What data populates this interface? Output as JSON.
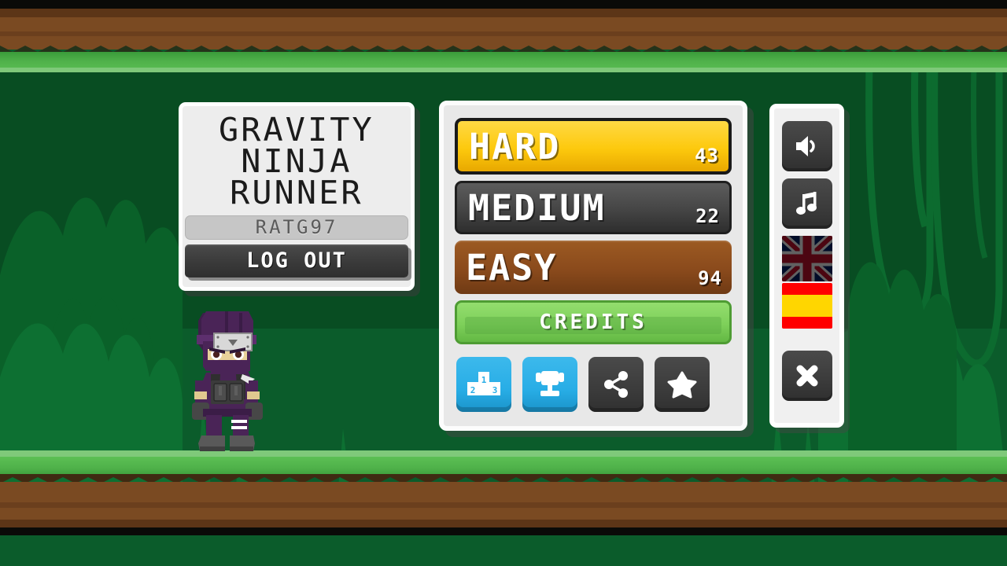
{
  "app": {
    "title_lines": [
      "GRAVITY",
      "NINJA",
      "RUNNER"
    ],
    "username": "RATG97",
    "logout_label": "LOG OUT"
  },
  "menu": {
    "difficulties": [
      {
        "label": "HARD",
        "score": "43",
        "color": "#fdc90d",
        "selected": true
      },
      {
        "label": "MEDIUM",
        "score": "22",
        "color": "#454545",
        "selected": false
      },
      {
        "label": "EASY",
        "score": "94",
        "color": "#8a4a1c",
        "selected": false
      }
    ],
    "credits_label": "CREDITS",
    "icons": [
      {
        "name": "leaderboard-icon",
        "style": "blue",
        "numbers": [
          "1",
          "2",
          "3"
        ]
      },
      {
        "name": "achievements-icon",
        "style": "blue"
      },
      {
        "name": "share-icon",
        "style": "dark"
      },
      {
        "name": "rate-star-icon",
        "style": "dark"
      }
    ]
  },
  "sidebar": {
    "buttons": [
      {
        "name": "sound-toggle",
        "icon": "speaker-icon"
      },
      {
        "name": "music-toggle",
        "icon": "music-note-icon"
      },
      {
        "name": "language-en",
        "icon": "uk-flag-icon",
        "active": false
      },
      {
        "name": "language-es",
        "icon": "spain-flag-icon",
        "active": true
      },
      {
        "name": "close-button",
        "icon": "close-x-icon"
      }
    ]
  },
  "scene": {
    "character": "ninja-sprite",
    "background": "jungle-grass",
    "colors": {
      "grass_light": "#5cc054",
      "grass_dark": "#3a9b3a",
      "dirt": "#7a4a22",
      "dirt_dark": "#5c3517",
      "backdrop": "#0b5c2b",
      "backdrop_dark": "#084d22",
      "panel_bg": "#e8e8e8",
      "panel_border": "#ffffff",
      "accent_yellow": "#fdc90d",
      "accent_blue": "#28ade6",
      "accent_green": "#7ed05a",
      "accent_brown": "#8a4a1c"
    }
  }
}
